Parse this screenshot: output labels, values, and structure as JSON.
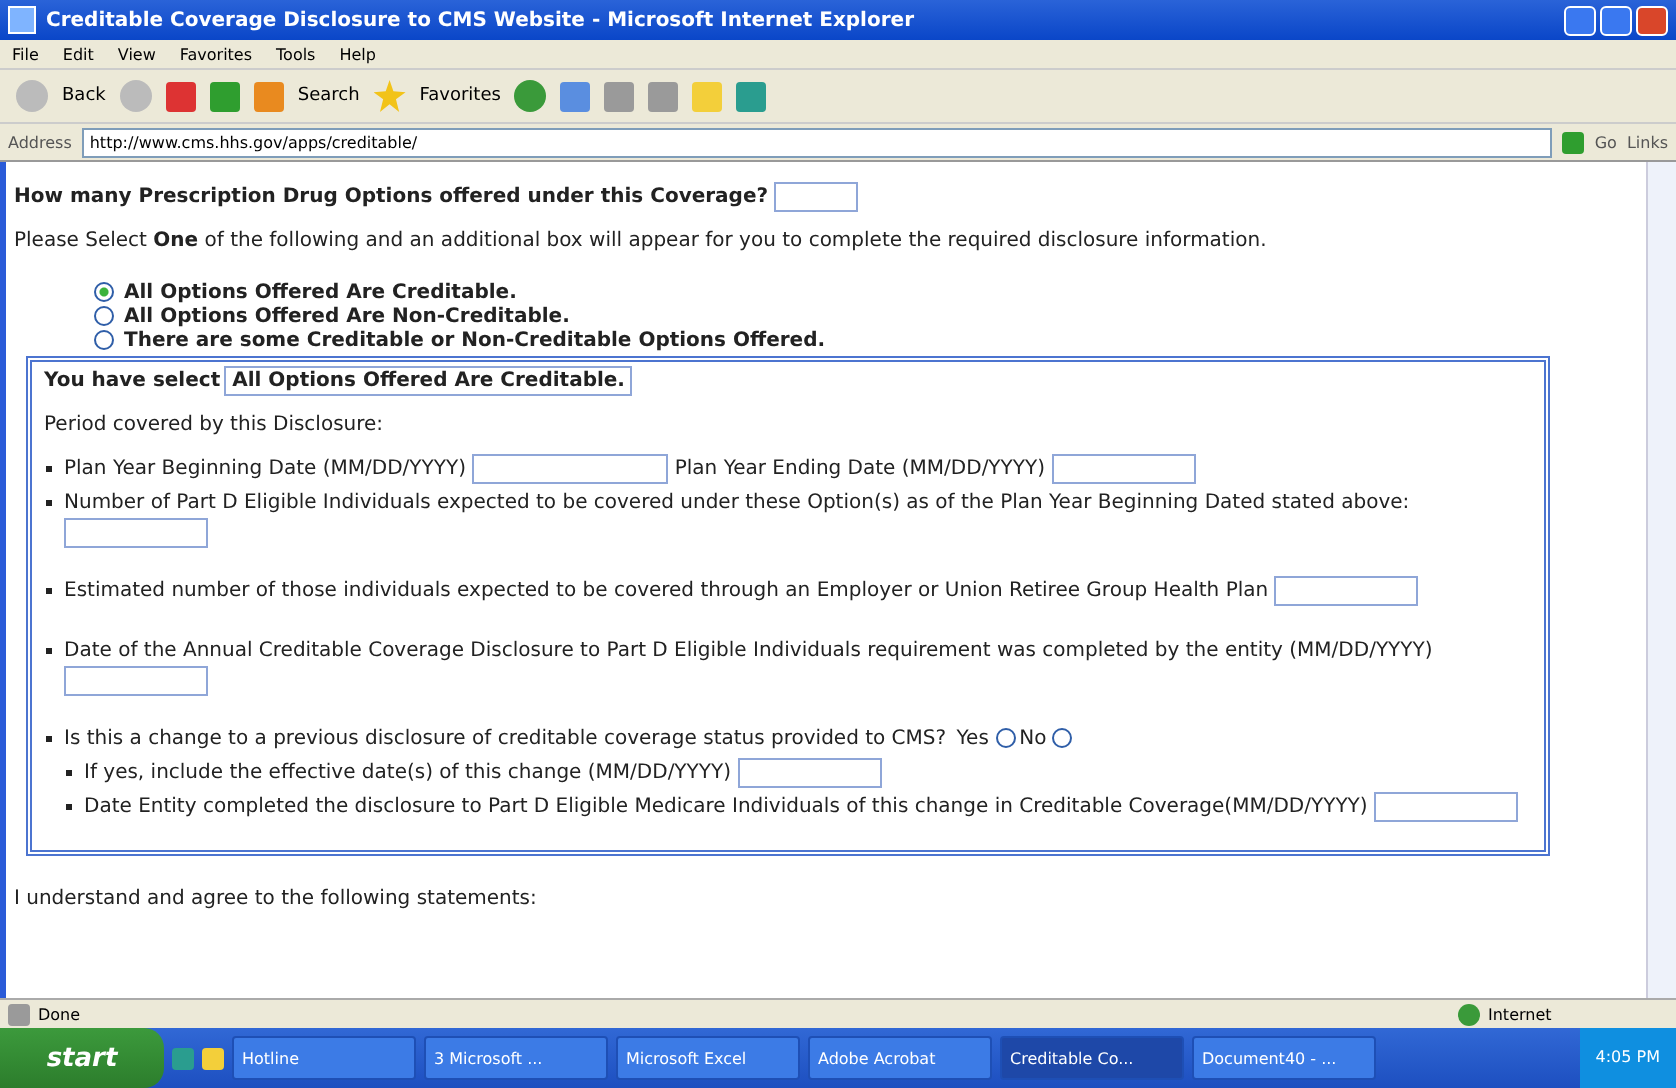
{
  "window": {
    "title": "Creditable Coverage Disclosure to CMS Website - Microsoft Internet Explorer"
  },
  "menu": [
    "File",
    "Edit",
    "View",
    "Favorites",
    "Tools",
    "Help"
  ],
  "toolbar": {
    "back": "Back",
    "search": "Search",
    "favorites": "Favorites"
  },
  "address_bar": {
    "label": "Address",
    "url": "http://www.cms.hhs.gov/apps/creditable/",
    "go": "Go",
    "links": "Links"
  },
  "page": {
    "question": "How many Prescription Drug Options offered under this Coverage?",
    "instruction": "Please Select **One** of the following and an additional box will appear for you to complete the required disclosure information.",
    "options": [
      {
        "label": "All Options Offered Are Creditable.",
        "selected": true
      },
      {
        "label": "All Options Offered Are Non-Creditable.",
        "selected": false
      },
      {
        "label": "There are some Creditable or Non-Creditable Options Offered.",
        "selected": false
      }
    ],
    "selection_label": "You have select",
    "selection_value": "All Options Offered Are Creditable.",
    "period_label": "Period covered by this Disclosure:",
    "begin_date_label": "Plan Year Beginning Date (MM/DD/YYYY)",
    "end_date_label": "Plan Year Ending Date (MM/DD/YYYY)",
    "individuals_label": "Number of Part D Eligible Individuals expected to be covered under these Option(s) as of the Plan Year Beginning Dated stated above:",
    "estimated_label": "Estimated number of those individuals expected to be covered through an Employer or Union Retiree Group Health Plan",
    "annual_label": "Date of the Annual Creditable Coverage Disclosure to Part D Eligible Individuals requirement was completed by the entity (MM/DD/YYYY)",
    "change_label": "Is this a change to a previous disclosure of creditable coverage status provided to CMS?",
    "change_options": [
      {
        "label": "Yes",
        "selected": false
      },
      {
        "label": "No",
        "selected": false
      }
    ],
    "effective_label": "If yes, include the effective date(s) of this change (MM/DD/YYYY)",
    "entity_label": "Date Entity completed the disclosure to Part D Eligible Medicare Individuals of this change in Creditable Coverage(MM/DD/YYYY)",
    "footer_text": "I understand and agree to the following statements:"
  },
  "status_bar": {
    "text": "Done",
    "zone": "Internet"
  },
  "taskbar": {
    "start": "start",
    "items": [
      "Hotline",
      "3 Microsoft ...",
      "Microsoft Excel",
      "Adobe Acrobat",
      "Creditable Co...",
      "Document40 - ..."
    ],
    "clock": "4:05 PM"
  }
}
